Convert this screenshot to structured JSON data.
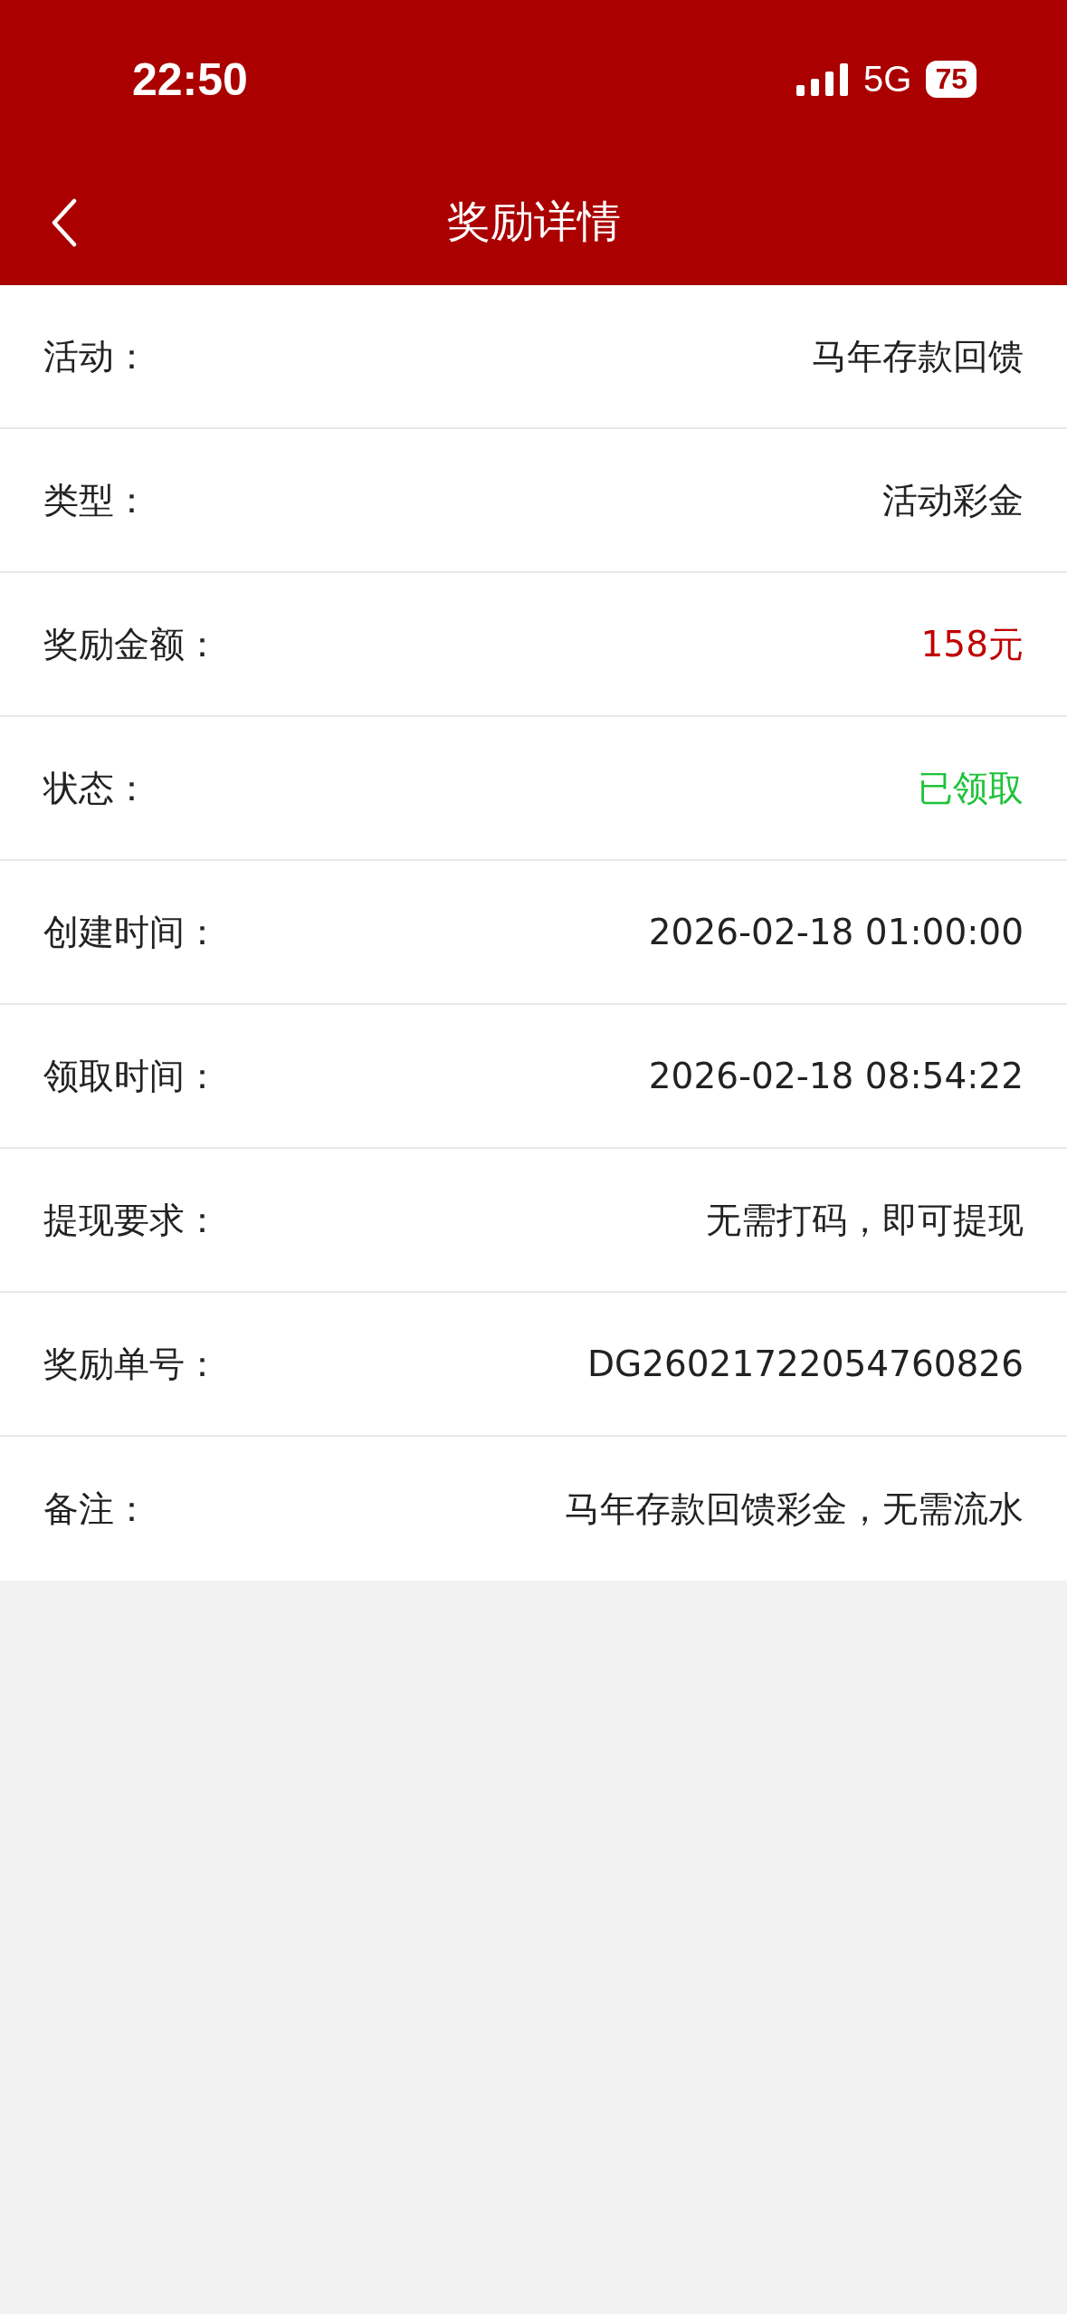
{
  "status_bar": {
    "time": "22:50",
    "network": "5G",
    "battery": "75"
  },
  "nav": {
    "title": "奖励详情"
  },
  "rows": [
    {
      "label": "活动：",
      "value": "马年存款回馈"
    },
    {
      "label": "类型：",
      "value": "活动彩金"
    },
    {
      "label": "奖励金额：",
      "value": "158元",
      "color": "#c00000"
    },
    {
      "label": "状态：",
      "value": "已领取",
      "color": "#1fc23a"
    },
    {
      "label": "创建时间：",
      "value": "2026-02-18 01:00:00"
    },
    {
      "label": "领取时间：",
      "value": "2026-02-18 08:54:22"
    },
    {
      "label": "提现要求：",
      "value": "无需打码，即可提现"
    },
    {
      "label": "奖励单号：",
      "value": "DG26021722054760826"
    },
    {
      "label": "备注：",
      "value": "马年存款回馈彩金，无需流水"
    }
  ]
}
